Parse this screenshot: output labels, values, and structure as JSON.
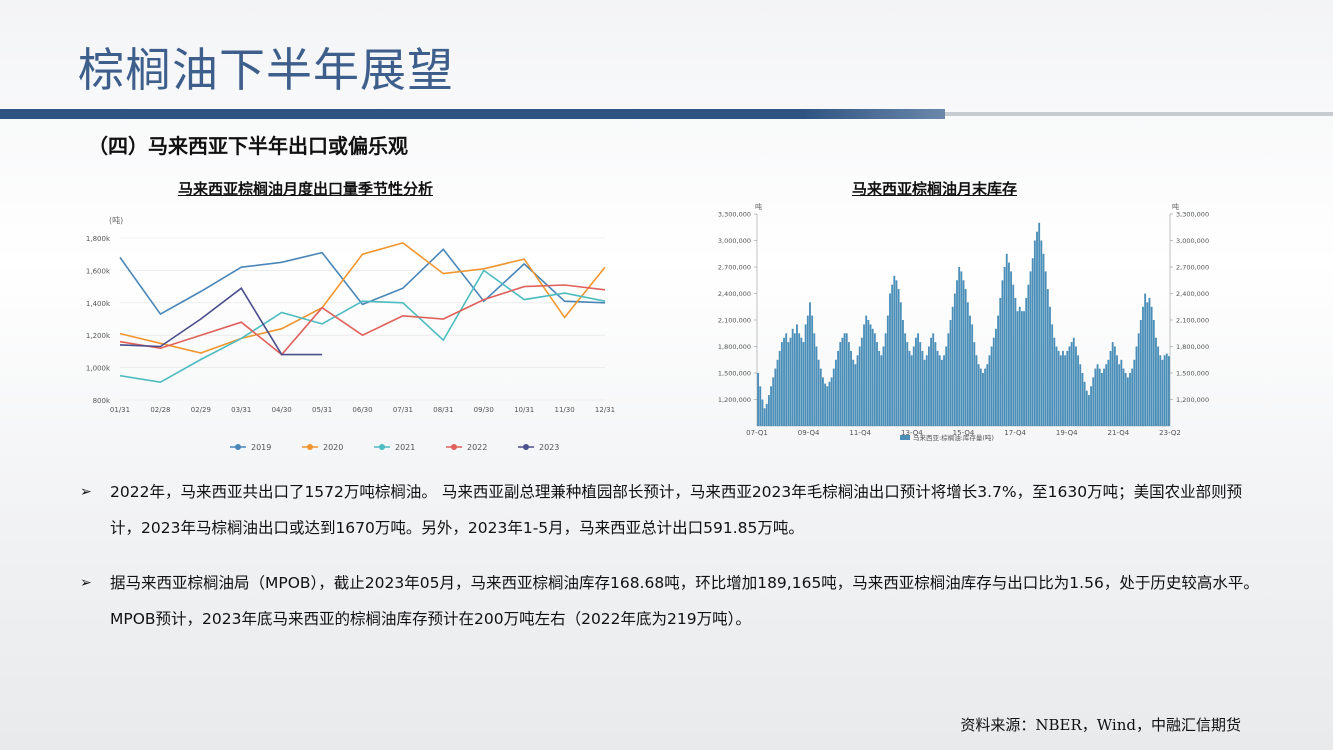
{
  "page": {
    "title": "棕榈油下半年展望",
    "subtitle": "（四）马来西亚下半年出口或偏乐观",
    "source": "资料来源：NBER，Wind，中融汇信期货"
  },
  "bullets": [
    {
      "marker": "➢",
      "text": "2022年，马来西亚共出口了1572万吨棕榈油。 马来西亚副总理兼种植园部长预计，马来西亚2023年毛棕榈油出口预计将增长3.7%，至1630万吨；美国农业部则预计，2023年马棕榈油出口或达到1670万吨。另外，2023年1-5月，马来西亚总计出口591.85万吨。"
    },
    {
      "marker": "➢",
      "text": "据马来西亚棕榈油局（MPOB），截止2023年05月，马来西亚棕榈油库存168.68吨，环比增加189,165吨，马来西亚棕榈油库存与出口比为1.56，处于历史较高水平。MPOB预计，2023年底马来西亚的棕榈油库存预计在200万吨左右（2022年底为219万吨）。"
    }
  ],
  "chart_data": [
    {
      "type": "line",
      "title": "马来西亚棕榈油月度出口量季节性分析",
      "unit_label": "(吨)",
      "x": [
        "01/31",
        "02/28",
        "02/29",
        "03/31",
        "04/30",
        "05/31",
        "06/30",
        "07/31",
        "08/31",
        "09/30",
        "10/31",
        "11/30",
        "12/31"
      ],
      "ylim": [
        800,
        1800
      ],
      "yticks": [
        "800k",
        "1,000k",
        "1,200k",
        "1,400k",
        "1,600k",
        "1,800k"
      ],
      "yticks_values": [
        800,
        1000,
        1200,
        1400,
        1600,
        1800
      ],
      "legend_position": "bottom",
      "series": [
        {
          "name": "2019",
          "color": "#4a86b8",
          "values": [
            1680,
            1330,
            1470,
            1620,
            1650,
            1710,
            1390,
            1490,
            1730,
            1410,
            1640,
            1410,
            1400
          ]
        },
        {
          "name": "2020",
          "color": "#f0962e",
          "values": [
            1210,
            1150,
            1090,
            1180,
            1240,
            1370,
            1700,
            1770,
            1580,
            1610,
            1670,
            1310,
            1620
          ]
        },
        {
          "name": "2021",
          "color": "#4cbcc0",
          "values": [
            950,
            910,
            1050,
            1180,
            1340,
            1270,
            1410,
            1400,
            1170,
            1600,
            1420,
            1460,
            1410
          ]
        },
        {
          "name": "2022",
          "color": "#e0605a",
          "values": [
            1160,
            1120,
            1200,
            1280,
            1080,
            1370,
            1200,
            1320,
            1300,
            1420,
            1500,
            1510,
            1480
          ]
        },
        {
          "name": "2023",
          "color": "#4a4e8c",
          "values": [
            1140,
            1130,
            1300,
            1490,
            1080,
            1080,
            null,
            null,
            null,
            null,
            null,
            null,
            null
          ]
        }
      ]
    },
    {
      "type": "bar",
      "title": "马来西亚棕榈油月末库存",
      "unit_label": "吨",
      "legend": "马来西亚:棕榈油:库存量(吨)",
      "ylim": [
        900000,
        3300000
      ],
      "yticks": [
        "1,200,000",
        "1,500,000",
        "1,800,000",
        "2,100,000",
        "2,400,000",
        "2,700,000",
        "3,000,000",
        "3,300,000"
      ],
      "yticks_values": [
        1200000,
        1500000,
        1800000,
        2100000,
        2400000,
        2700000,
        3000000,
        3300000
      ],
      "xticks": [
        "07-Q1",
        "09-Q4",
        "11-Q4",
        "13-Q4",
        "15-Q4",
        "17-Q4",
        "19-Q4",
        "21-Q4",
        "23-Q2"
      ],
      "color": "#4b8fb8",
      "values": [
        1500000,
        1350000,
        1200000,
        1100000,
        1150000,
        1250000,
        1350000,
        1450000,
        1550000,
        1650000,
        1750000,
        1850000,
        1900000,
        1950000,
        1850000,
        1900000,
        2000000,
        1950000,
        2050000,
        1950000,
        1900000,
        1850000,
        2050000,
        2150000,
        2300000,
        2150000,
        1950000,
        1800000,
        1650000,
        1550000,
        1450000,
        1380000,
        1350000,
        1400000,
        1450000,
        1550000,
        1650000,
        1750000,
        1850000,
        1900000,
        1950000,
        1950000,
        1850000,
        1750000,
        1650000,
        1600000,
        1700000,
        1800000,
        1900000,
        2050000,
        2150000,
        2100000,
        2050000,
        2000000,
        1950000,
        1850000,
        1750000,
        1700000,
        1800000,
        1950000,
        2150000,
        2400000,
        2500000,
        2600000,
        2550000,
        2450000,
        2300000,
        2100000,
        1950000,
        1850000,
        1750000,
        1700000,
        1800000,
        1900000,
        1950000,
        1850000,
        1750000,
        1650000,
        1700000,
        1800000,
        1900000,
        1950000,
        1850000,
        1750000,
        1700000,
        1650000,
        1700000,
        1800000,
        1950000,
        2100000,
        2250000,
        2400000,
        2550000,
        2700000,
        2650000,
        2550000,
        2450000,
        2300000,
        2150000,
        2050000,
        1850000,
        1700000,
        1600000,
        1550000,
        1500000,
        1550000,
        1600000,
        1700000,
        1800000,
        1900000,
        2000000,
        2150000,
        2350000,
        2550000,
        2700000,
        2850000,
        2750000,
        2650000,
        2500000,
        2350000,
        2200000,
        2250000,
        2200000,
        2200000,
        2350000,
        2500000,
        2650000,
        2800000,
        3000000,
        3100000,
        3200000,
        3000000,
        2850000,
        2650000,
        2450000,
        2250000,
        2050000,
        1900000,
        1800000,
        1750000,
        1700000,
        1750000,
        1700000,
        1750000,
        1800000,
        1850000,
        1900000,
        1800000,
        1700000,
        1600000,
        1500000,
        1400000,
        1300000,
        1250000,
        1350000,
        1450000,
        1550000,
        1600000,
        1550000,
        1500000,
        1550000,
        1600000,
        1650000,
        1750000,
        1850000,
        1800000,
        1700000,
        1600000,
        1650000,
        1550000,
        1500000,
        1450000,
        1500000,
        1550000,
        1650000,
        1800000,
        1950000,
        2100000,
        2250000,
        2400000,
        2300000,
        2350000,
        2250000,
        2100000,
        1900000,
        1800000,
        1700000,
        1650000,
        1700000,
        1720000,
        1690000
      ]
    }
  ]
}
